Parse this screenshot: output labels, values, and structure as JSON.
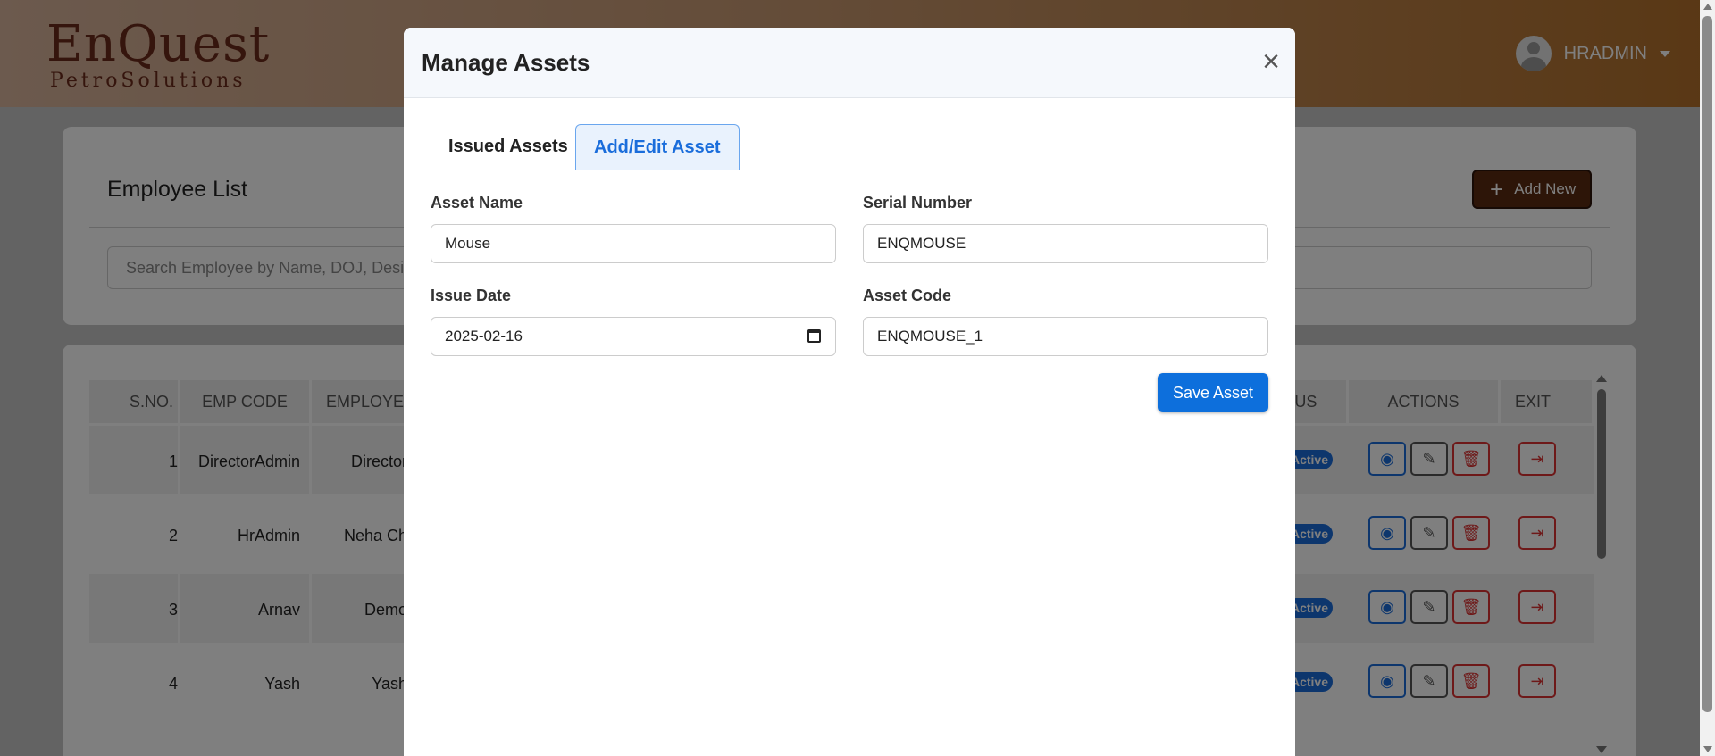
{
  "header": {
    "logo": {
      "main": "EnQuest",
      "sub": "PetroSolutions"
    },
    "user_name": "HRADMIN"
  },
  "employee_card": {
    "title": "Employee List",
    "add_new_label": "Add New",
    "search_placeholder": "Search Employee by Name, DOJ, Desig"
  },
  "table": {
    "headers": [
      "S.NO.",
      "EMP CODE",
      "EMPLOYEE",
      "TATUS",
      "ACTIONS",
      "EXIT"
    ],
    "rows": [
      {
        "sno": "1",
        "emp_code": "DirectorAdmin",
        "employee": "Director",
        "status": "Active"
      },
      {
        "sno": "2",
        "emp_code": "HrAdmin",
        "employee": "Neha Ch",
        "status": "Active"
      },
      {
        "sno": "3",
        "emp_code": "Arnav",
        "employee": "Demo",
        "status": "Active"
      },
      {
        "sno": "4",
        "emp_code": "Yash",
        "employee": "Yash",
        "status": "Active"
      }
    ]
  },
  "modal": {
    "title": "Manage Assets",
    "close_symbol": "×",
    "tabs": [
      {
        "label": "Issued Assets",
        "active": false
      },
      {
        "label": "Add/Edit Asset",
        "active": true
      }
    ],
    "form": {
      "asset_name": {
        "label": "Asset Name",
        "value": "Mouse"
      },
      "serial_number": {
        "label": "Serial Number",
        "value": "ENQMOUSE"
      },
      "issue_date": {
        "label": "Issue Date",
        "value": "2025-02-16"
      },
      "asset_code": {
        "label": "Asset Code",
        "value": "ENQMOUSE_1"
      }
    },
    "save_label": "Save Asset"
  },
  "colors": {
    "primary": "#0d6fdc",
    "brand_dark": "#5a2a10",
    "danger": "#dd3333"
  }
}
